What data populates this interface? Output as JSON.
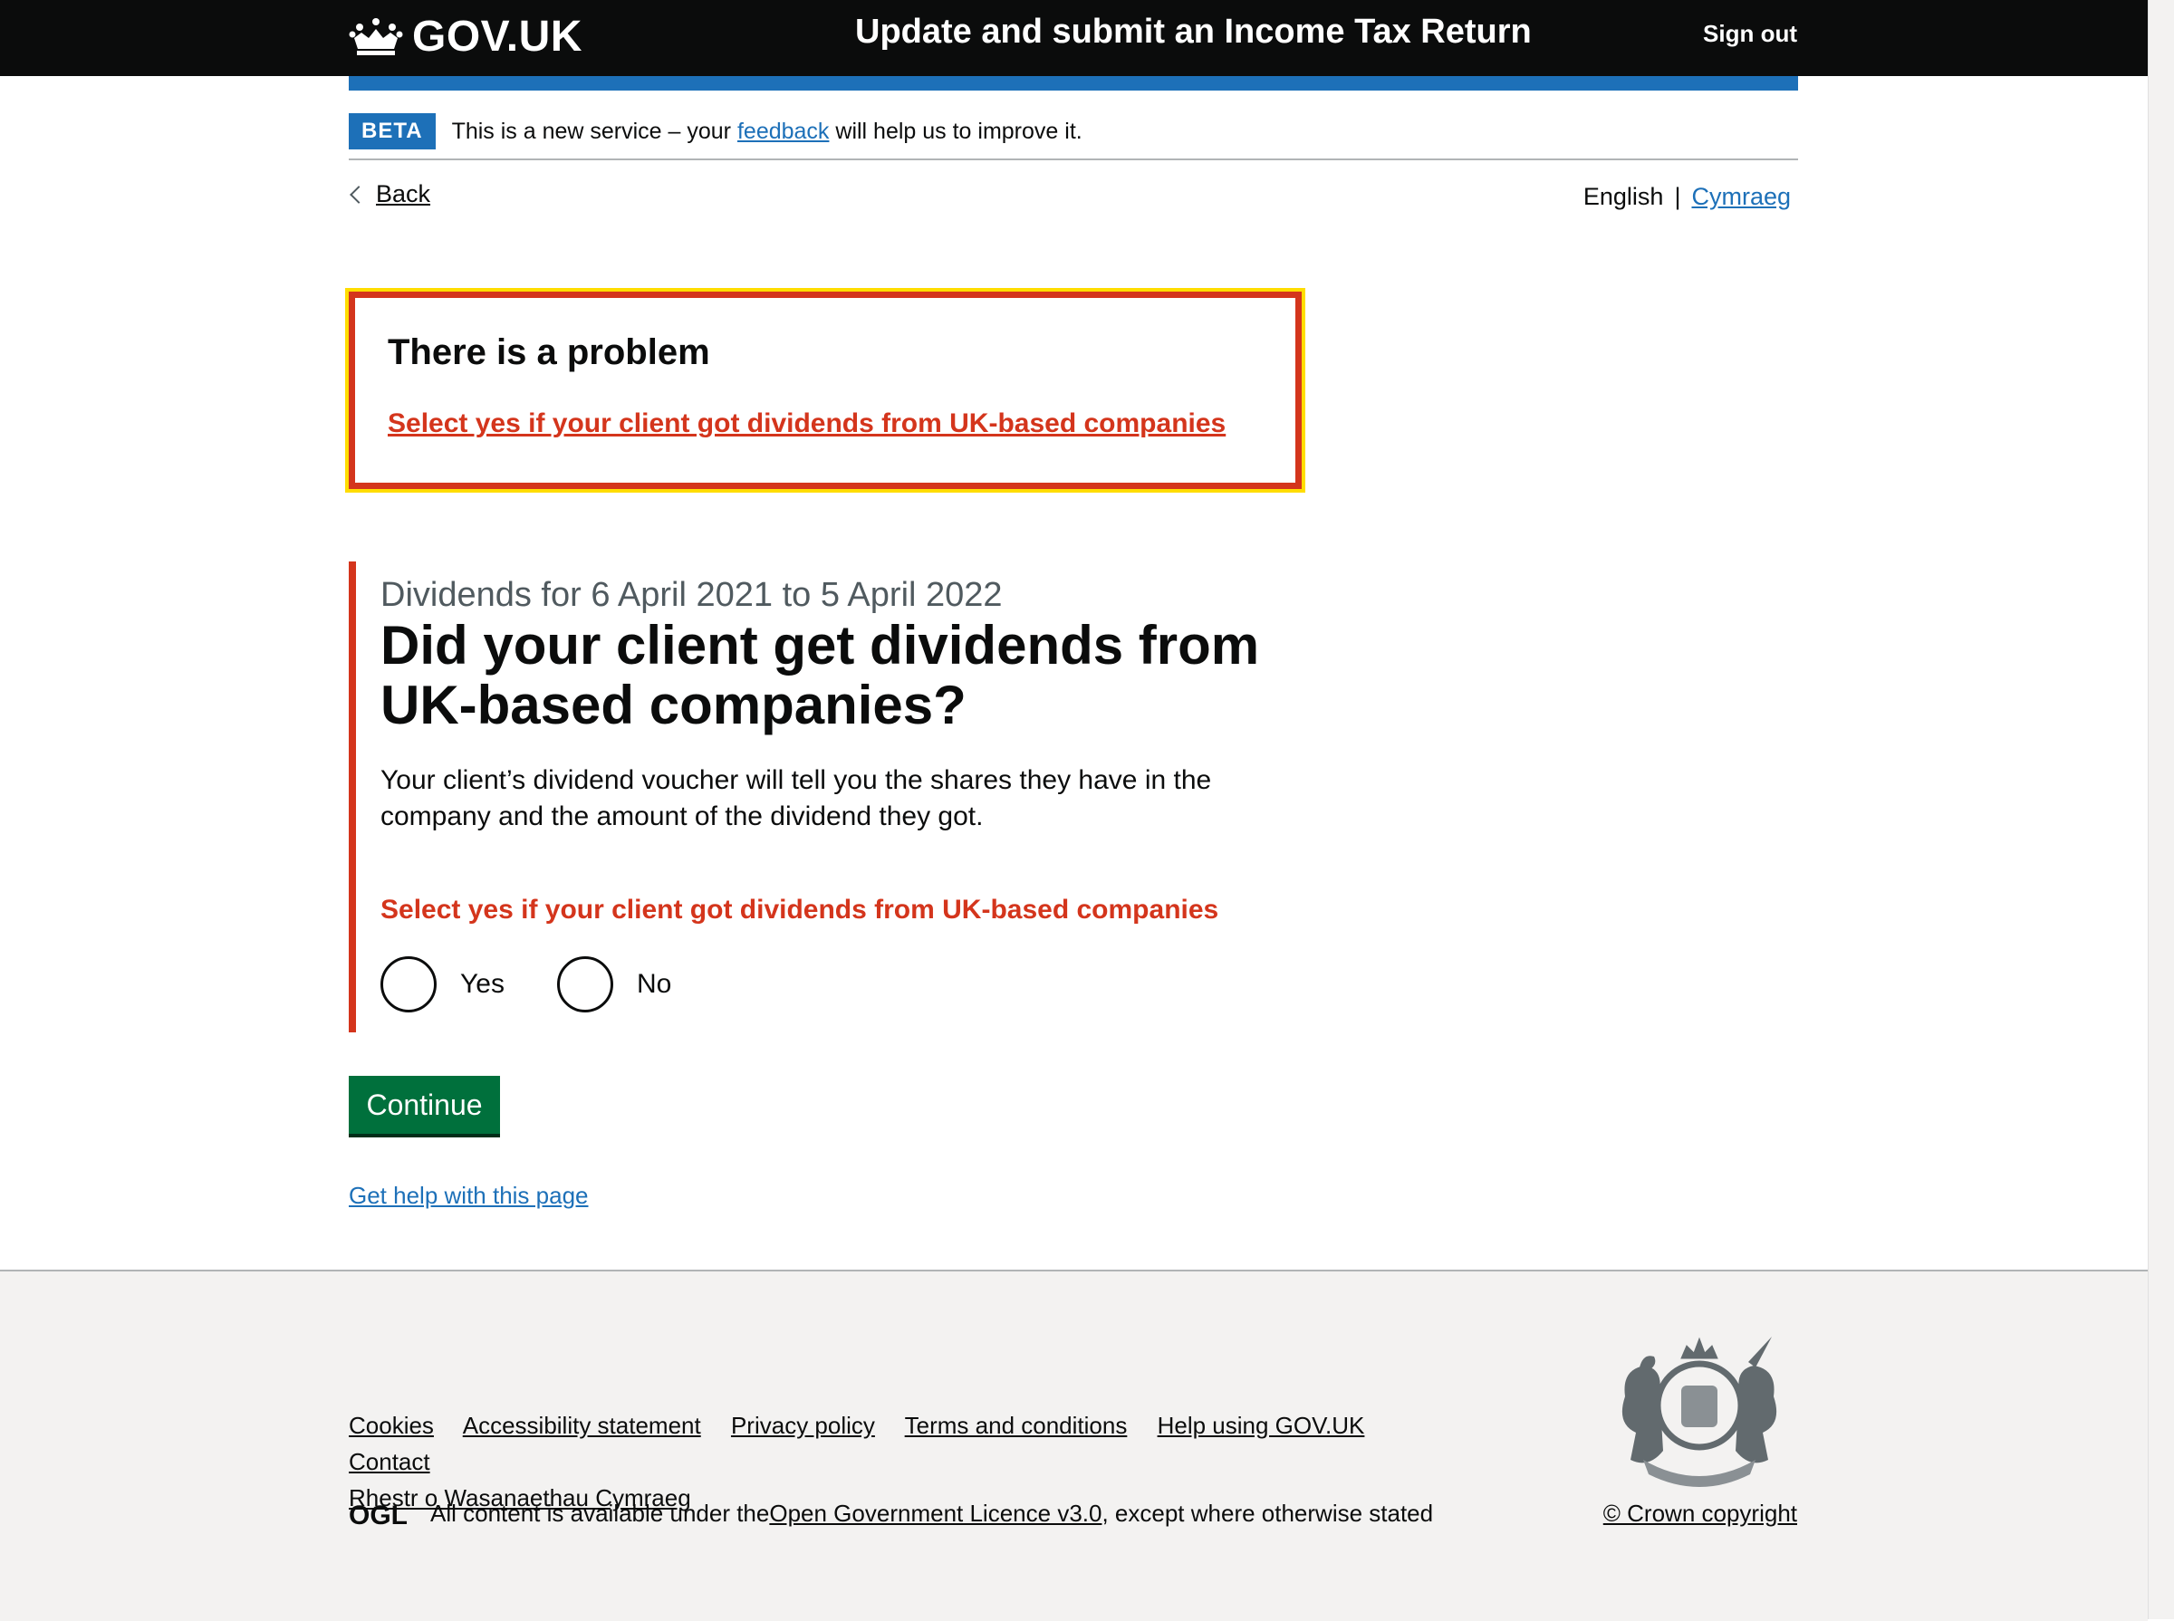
{
  "header": {
    "logo_text": "GOV.UK",
    "service_name": "Update and submit an Income Tax Return",
    "sign_out": "Sign out"
  },
  "phase_banner": {
    "tag": "BETA",
    "text_before": "This is a new service – your ",
    "link": "feedback",
    "text_after": " will help us to improve it."
  },
  "nav": {
    "back": "Back",
    "language_current": "English",
    "language_separator": "|",
    "language_other": "Cymraeg"
  },
  "error_summary": {
    "title": "There is a problem",
    "error_link": "Select yes if your client got dividends from UK-based companies"
  },
  "question": {
    "caption": "Dividends for 6 April 2021 to 5 April 2022",
    "heading": "Did your client get dividends from UK-based companies?",
    "hint": "Your client’s dividend voucher will tell you the shares they have in the company and the amount of the dividend they got.",
    "error_message": "Select yes if your client got dividends from UK-based companies",
    "options": [
      "Yes",
      "No"
    ]
  },
  "actions": {
    "continue": "Continue",
    "help": "Get help with this page"
  },
  "footer": {
    "links": [
      "Cookies",
      "Accessibility statement",
      "Privacy policy",
      "Terms and conditions",
      "Help using GOV.UK",
      "Contact",
      "Rhestr o Wasanaethau Cymraeg"
    ],
    "licence_before": "All content is available under the ",
    "licence_link": "Open Government Licence v3.0",
    "licence_after": ", except where otherwise stated",
    "copyright": "© Crown copyright",
    "ogl_logo_text": "OGL"
  },
  "colors": {
    "header_bg": "#0b0c0c",
    "brand_blue": "#1d70b8",
    "error_red": "#d4351c",
    "focus_yellow": "#ffdd00",
    "button_green": "#00703c",
    "footer_bg": "#f3f2f1"
  }
}
